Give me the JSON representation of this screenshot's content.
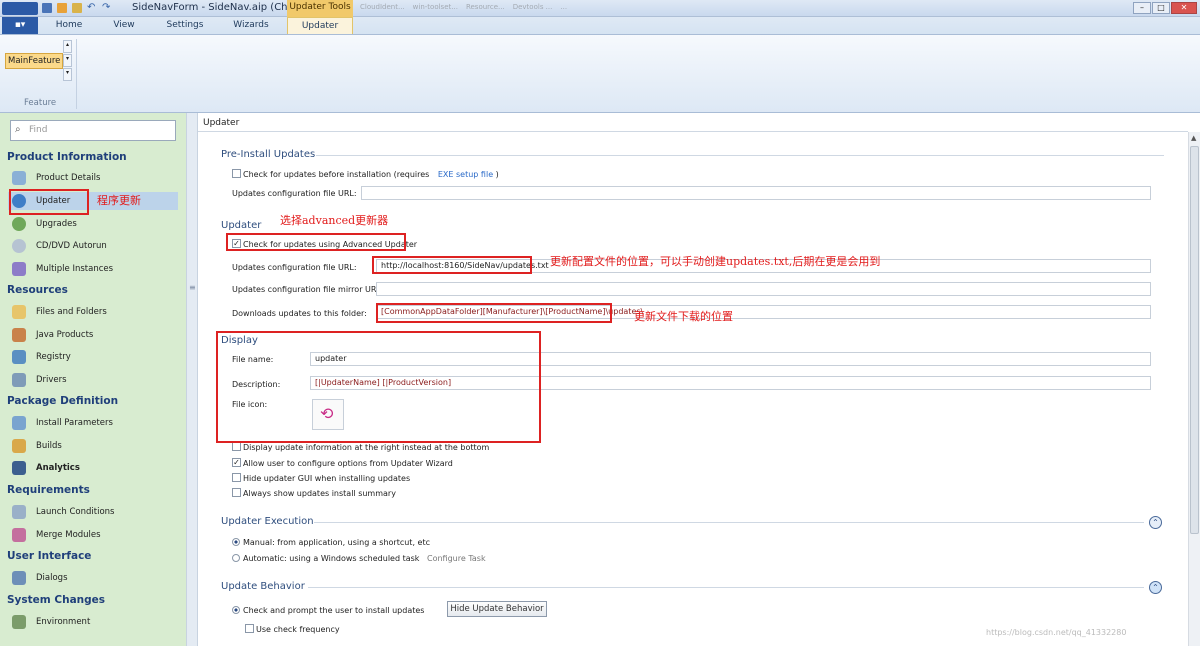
{
  "titlebar": {
    "title": "SideNavForm - SideNav.aip (Chine...",
    "context_tab": "Updater Tools",
    "bg_tabs": [
      "CloudIdent...",
      "win-toolset...",
      "Resource...",
      "Devtools ...",
      "..."
    ]
  },
  "ribbon": {
    "tabs": [
      "Home",
      "View",
      "Settings",
      "Wizards",
      "Updater"
    ],
    "active_tab": "Updater",
    "feature_value": "MainFeature",
    "feature_group": "Feature"
  },
  "sidebar": {
    "search_placeholder": "Find",
    "groups": [
      {
        "title": "Product Information",
        "items": [
          "Product Details",
          "Updater",
          "Upgrades",
          "CD/DVD Autorun",
          "Multiple Instances"
        ]
      },
      {
        "title": "Resources",
        "items": [
          "Files and Folders",
          "Java Products",
          "Registry",
          "Drivers"
        ]
      },
      {
        "title": "Package Definition",
        "items": [
          "Install Parameters",
          "Builds",
          "Analytics"
        ]
      },
      {
        "title": "Requirements",
        "items": [
          "Launch Conditions",
          "Merge Modules"
        ]
      },
      {
        "title": "User Interface",
        "items": [
          "Dialogs"
        ]
      },
      {
        "title": "System Changes",
        "items": [
          "Environment"
        ]
      }
    ],
    "selected_item": "Updater"
  },
  "main": {
    "header": "Updater",
    "pre_install": {
      "title": "Pre-Install Updates",
      "check_label_a": "Check for updates before installation (requires",
      "check_link": "EXE setup file",
      "check_label_b": ")",
      "config_url_label": "Updates configuration file URL:"
    },
    "updater": {
      "title": "Updater",
      "check_label": "Check for updates using Advanced Updater",
      "config_url_label": "Updates configuration file URL:",
      "config_url_value": "http://localhost:8160/SideNav/updates.txt",
      "mirror_label": "Updates configuration file mirror URL:",
      "download_label": "Downloads updates to this folder:",
      "download_value": "[CommonAppDataFolder][Manufacturer]\\[ProductName]\\updates\\"
    },
    "display": {
      "title": "Display",
      "filename_label": "File name:",
      "filename_value": "updater",
      "desc_label": "Description:",
      "desc_value": "[|UpdaterName] [|ProductVersion]",
      "icon_label": "File icon:"
    },
    "options": [
      {
        "label": "Display update information at the right instead at the bottom",
        "checked": false
      },
      {
        "label": "Allow user to configure options from Updater Wizard",
        "checked": true
      },
      {
        "label": "Hide updater GUI when installing updates",
        "checked": false
      },
      {
        "label": "Always show updates install summary",
        "checked": false
      }
    ],
    "execution": {
      "title": "Updater Execution",
      "manual": "Manual: from application, using a shortcut, etc",
      "automatic": "Automatic: using a Windows scheduled task",
      "configure_task": "Configure Task"
    },
    "behavior": {
      "title": "Update Behavior",
      "prompt": "Check and prompt the user to install updates",
      "hide_button": "Hide Update Behavior",
      "frequency": "Use check frequency"
    }
  },
  "annotations": {
    "updater_note": "程序更新",
    "advanced_note": "选择advanced更新器",
    "config_note": "更新配置文件的位置，可以手动创建updates.txt,后期在更是会用到",
    "download_note": "更新文件下载的位置"
  },
  "watermark": "https://blog.csdn.net/qq_41332280",
  "colors": {
    "annotation": "#e21a1a",
    "link": "#2a6ac8",
    "path_text": "#8a1a1a"
  }
}
